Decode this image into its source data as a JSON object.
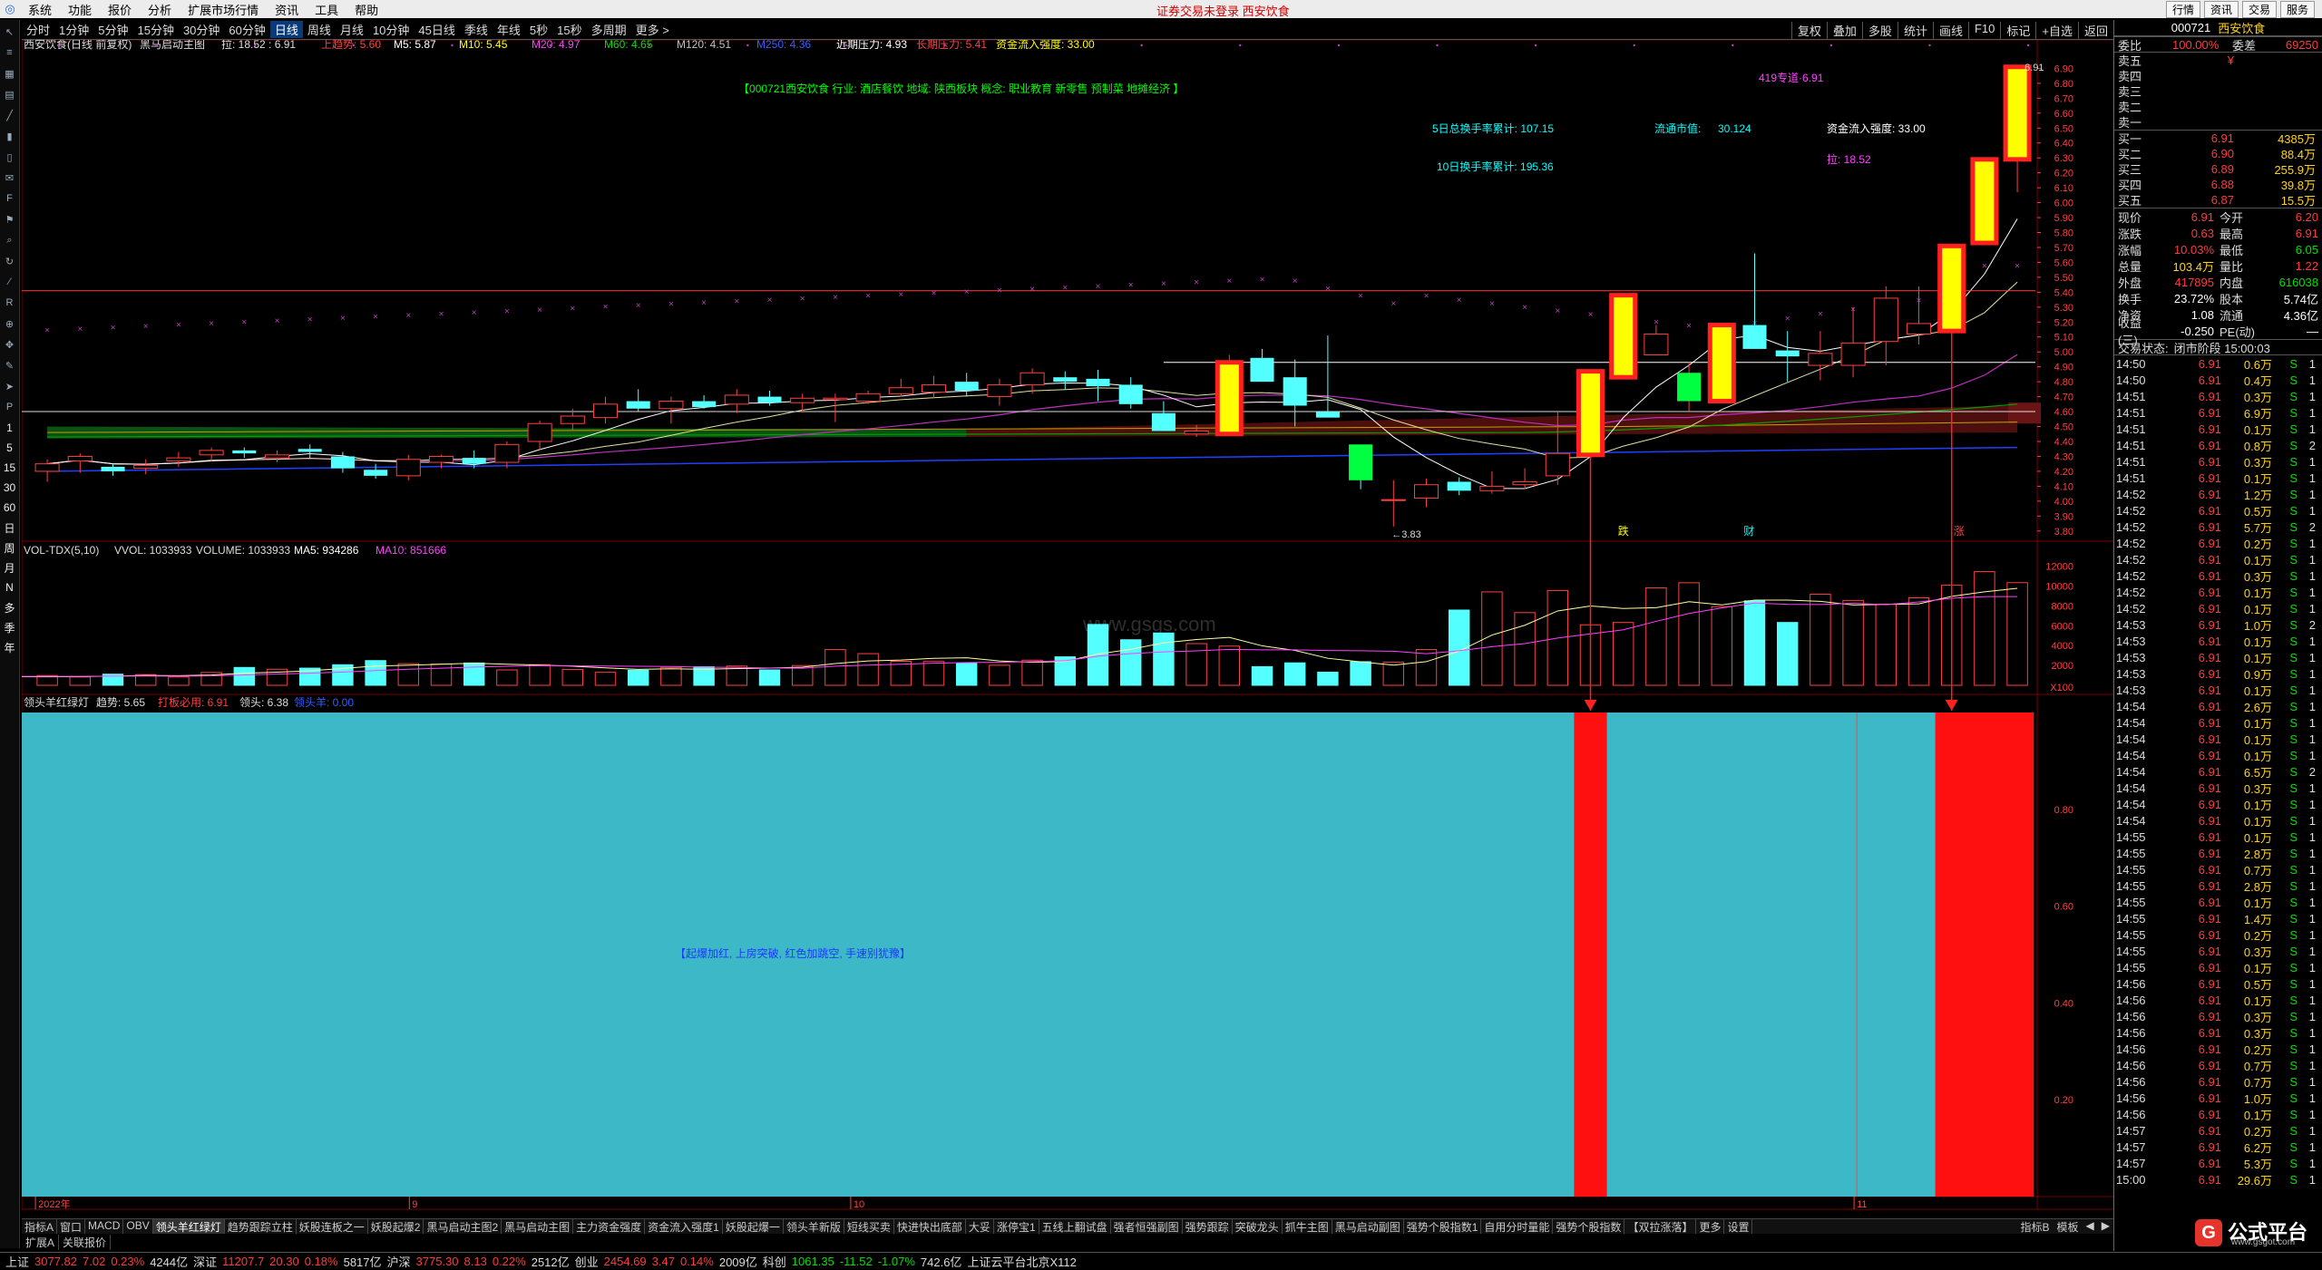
{
  "menubar": {
    "items": [
      "系统",
      "功能",
      "报价",
      "分析",
      "扩展市场行情",
      "资讯",
      "工具",
      "帮助"
    ],
    "center_text": "证券交易未登录  西安饮食",
    "right_buttons": [
      "行情",
      "资讯",
      "交易",
      "服务"
    ]
  },
  "periodbar": {
    "items": [
      "分时",
      "1分钟",
      "5分钟",
      "15分钟",
      "30分钟",
      "60分钟",
      "日线",
      "周线",
      "月线",
      "10分钟",
      "45日线",
      "季线",
      "年线",
      "5秒",
      "15秒",
      "多周期",
      "更多 >"
    ],
    "active": "日线",
    "right_items": [
      "复权",
      "叠加",
      "多股",
      "统计",
      "画线",
      "F10",
      "标记",
      "+自选",
      "返回"
    ]
  },
  "lefttools": {
    "icons": [
      "cursor-icon",
      "list-icon",
      "grid-icon",
      "table-icon",
      "chart-icon",
      "candle-icon",
      "bars-icon",
      "news-icon",
      "f10-icon",
      "flag-icon",
      "search-icon",
      "refresh-icon",
      "line-icon",
      "rsi-icon",
      "zoom-icon",
      "move-icon",
      "pen-icon",
      "pointer-icon",
      "ps-icon"
    ],
    "cycle_labels": [
      "1",
      "5",
      "15",
      "30",
      "60",
      "日",
      "周",
      "月",
      "N",
      "多",
      "季",
      "年"
    ]
  },
  "main_info": {
    "stock_label": "西安饮食(日线 前复权)",
    "indicator_name": "黑马启动主图",
    "values_text": "拉: 18.52 : 6.91",
    "ma_items": [
      {
        "text": "上趋势: 5.60",
        "color": "#ff4040"
      },
      {
        "text": "M5: 5.87",
        "color": "#ffffff"
      },
      {
        "text": "M10: 5.45",
        "color": "#ffff00"
      },
      {
        "text": "M20: 4.97",
        "color": "#ff40ff"
      },
      {
        "text": "M60: 4.65",
        "color": "#00e000"
      },
      {
        "text": "M120: 4.51",
        "color": "#c0c0c0"
      },
      {
        "text": "M250: 4.36",
        "color": "#3060ff"
      },
      {
        "text": "近期压力: 4.93",
        "color": "#ffffff"
      },
      {
        "text": "长期压力: 5.41",
        "color": "#ff4040"
      },
      {
        "text": "资金流入强度: 33.00",
        "color": "#ffff00"
      }
    ],
    "info_bar": "【000721西安饮食  行业: 酒店餐饮  地域: 陕西板块  概念: 职业教育 新零售 预制菜 地摊经济 】",
    "header_419": "419专道·6.91",
    "peak_label": "6.91",
    "low_label": "3.83",
    "stats": [
      {
        "label": "5日总换手率累计: 107.15"
      },
      {
        "label": "流通市值:",
        "value": "30.124"
      },
      {
        "label": "资金流入强度: 33.00"
      },
      {
        "label": "拉: 18.52"
      },
      {
        "label": "10日换手率累计: 195.36"
      }
    ],
    "watermark": "www.gsgs.com",
    "markers": [
      "跌",
      "财",
      "涨"
    ]
  },
  "volume_info": {
    "name": "VOL-TDX(5,10)",
    "vvol": "VVOL: 1033933",
    "volume": "VOLUME: 1033933",
    "ma5": "MA5: 934286",
    "ma10": "MA10: 851666",
    "unit": "X100"
  },
  "signal_info": {
    "name": "领头羊红绿灯",
    "trend": "趋势: 5.65",
    "stop": "打板必用: 6.91",
    "lead": "领头: 6.38",
    "lead_hard": "领头羊: 0.00",
    "center_text": "【起爆加红, 上房突破, 红色加跳空, 手速别犹豫】"
  },
  "xaxis": {
    "labels": [
      "2022年",
      "9",
      "10",
      "11"
    ]
  },
  "chart_data": [
    {
      "type": "candlestick",
      "title": "黑马启动主图",
      "y_ticks": [
        "6.90",
        "6.80",
        "6.70",
        "6.60",
        "6.50",
        "6.40",
        "6.30",
        "6.20",
        "6.10",
        "6.00",
        "5.90",
        "5.80",
        "5.70",
        "5.60",
        "5.50",
        "5.40",
        "5.30",
        "5.20",
        "5.10",
        "5.00",
        "4.90",
        "4.80",
        "4.70",
        "4.60",
        "4.50",
        "4.40",
        "4.30",
        "4.20",
        "4.10",
        "4.00",
        "3.90",
        "3.80"
      ],
      "ylim": [
        3.75,
        7.03
      ],
      "candles": [
        [
          4.2,
          4.28,
          4.13,
          4.25
        ],
        [
          4.27,
          4.32,
          4.19,
          4.3
        ],
        [
          4.23,
          4.25,
          4.17,
          4.2
        ],
        [
          4.22,
          4.28,
          4.18,
          4.24
        ],
        [
          4.27,
          4.33,
          4.23,
          4.29
        ],
        [
          4.31,
          4.36,
          4.27,
          4.34
        ],
        [
          4.34,
          4.36,
          4.29,
          4.32
        ],
        [
          4.29,
          4.34,
          4.26,
          4.31
        ],
        [
          4.35,
          4.38,
          4.29,
          4.33
        ],
        [
          4.3,
          4.33,
          4.19,
          4.22
        ],
        [
          4.21,
          4.25,
          4.15,
          4.17
        ],
        [
          4.17,
          4.31,
          4.14,
          4.28
        ],
        [
          4.26,
          4.31,
          4.22,
          4.3
        ],
        [
          4.29,
          4.34,
          4.22,
          4.25
        ],
        [
          4.26,
          4.4,
          4.22,
          4.38
        ],
        [
          4.4,
          4.54,
          4.34,
          4.52
        ],
        [
          4.52,
          4.62,
          4.47,
          4.57
        ],
        [
          4.56,
          4.7,
          4.52,
          4.65
        ],
        [
          4.67,
          4.75,
          4.6,
          4.62
        ],
        [
          4.62,
          4.7,
          4.52,
          4.67
        ],
        [
          4.67,
          4.71,
          4.62,
          4.63
        ],
        [
          4.65,
          4.75,
          4.59,
          4.71
        ],
        [
          4.7,
          4.74,
          4.64,
          4.66
        ],
        [
          4.66,
          4.72,
          4.6,
          4.69
        ],
        [
          4.68,
          4.72,
          4.53,
          4.69
        ],
        [
          4.67,
          4.74,
          4.65,
          4.72
        ],
        [
          4.72,
          4.82,
          4.7,
          4.76
        ],
        [
          4.73,
          4.84,
          4.69,
          4.78
        ],
        [
          4.8,
          4.86,
          4.7,
          4.74
        ],
        [
          4.7,
          4.82,
          4.64,
          4.78
        ],
        [
          4.78,
          4.89,
          4.72,
          4.86
        ],
        [
          4.83,
          4.87,
          4.75,
          4.8
        ],
        [
          4.82,
          4.88,
          4.67,
          4.77
        ],
        [
          4.78,
          4.83,
          4.62,
          4.65
        ],
        [
          4.59,
          4.67,
          4.47,
          4.47
        ],
        [
          4.45,
          4.51,
          4.43,
          4.47
        ],
        [
          4.45,
          4.98,
          4.44,
          4.93
        ],
        [
          4.96,
          5.02,
          4.82,
          4.8
        ],
        [
          4.83,
          4.95,
          4.5,
          4.64
        ],
        [
          4.6,
          5.11,
          4.56,
          4.56
        ],
        [
          4.38,
          4.36,
          4.08,
          4.14
        ],
        [
          4.01,
          4.14,
          3.83,
          4.01
        ],
        [
          4.02,
          4.15,
          3.96,
          4.11
        ],
        [
          4.13,
          4.16,
          4.04,
          4.07
        ],
        [
          4.07,
          4.2,
          4.05,
          4.1
        ],
        [
          4.11,
          4.22,
          4.08,
          4.13
        ],
        [
          4.17,
          4.6,
          4.11,
          4.32
        ],
        [
          4.31,
          4.87,
          4.31,
          4.87
        ],
        [
          4.83,
          5.38,
          4.83,
          5.38
        ],
        [
          4.98,
          5.18,
          4.98,
          5.12
        ],
        [
          4.67,
          4.93,
          4.6,
          4.86
        ],
        [
          4.67,
          5.18,
          4.67,
          5.18
        ],
        [
          5.18,
          5.66,
          5.02,
          5.02
        ],
        [
          5.01,
          5.14,
          4.8,
          4.97
        ],
        [
          4.91,
          5.14,
          4.81,
          4.99
        ],
        [
          4.91,
          5.3,
          4.83,
          5.06
        ],
        [
          5.07,
          5.44,
          4.91,
          5.36
        ],
        [
          5.12,
          5.44,
          5.05,
          5.19
        ],
        [
          5.14,
          5.71,
          5.14,
          5.71
        ],
        [
          5.73,
          6.29,
          5.73,
          6.29
        ],
        [
          6.29,
          6.91,
          6.07,
          6.91
        ]
      ],
      "ma_last": {
        "M5": 5.87,
        "M10": 5.45,
        "M20": 4.97,
        "M60": 4.65,
        "M120": 4.51,
        "M250": 4.36
      },
      "resistance_near": 4.93,
      "resistance_far": 5.41,
      "support_line": 4.6
    },
    {
      "type": "bar",
      "title": "VOL-TDX(5,10)",
      "y_ticks": [
        "12000",
        "10000",
        "8000",
        "6000",
        "4000",
        "2000"
      ],
      "ylim": [
        0,
        12600
      ],
      "values": [
        1035,
        1035,
        720,
        870,
        780,
        930,
        980,
        840,
        1120,
        1080,
        840,
        1290,
        1800,
        1620,
        1730,
        2070,
        2490,
        2180,
        2140,
        2250,
        1550,
        2080,
        1600,
        1310,
        1520,
        1800,
        1870,
        1940,
        1550,
        1990,
        3600,
        3190,
        2420,
        2400,
        2230,
        2020,
        2530,
        2870,
        6130,
        4590,
        5270,
        4200,
        3950,
        1880,
        2260,
        1320,
        2380,
        2340,
        3600,
        7580,
        9410,
        7320,
        9550,
        6090,
        6330,
        9820,
        10330,
        7920,
        8510,
        6330,
        9170,
        8550,
        8180,
        8810,
        10080,
        11450,
        10340
      ]
    },
    {
      "type": "bar",
      "title": "领头羊红绿灯",
      "y_ticks": [
        "0.80",
        "0.60",
        "0.40",
        "0.20"
      ],
      "ylim": [
        0,
        1.0
      ],
      "values_red_indices": [
        47,
        58,
        59,
        60
      ]
    }
  ],
  "bottomtabs": [
    "指标A",
    "窗口",
    "MACD",
    "OBV",
    "领头羊红绿灯",
    "趋势跟踪立柱",
    "妖股连板之一",
    "妖股起爆2",
    "黑马启动主图2",
    "黑马启动主图",
    "主力资金强度",
    "资金流入强度1",
    "妖股起爆一",
    "领头羊新版",
    "短线买卖",
    "快进快出底部",
    "大妥",
    "涨停宝1",
    "五线上翻试盘",
    "强者恒强副图",
    "强势跟踪",
    "突破龙头",
    "抓牛主图",
    "黑马启动副图",
    "强势个股指数1",
    "自用分时量能",
    "强势个股指数",
    "【双拉涨落】",
    "更多",
    "设置"
  ],
  "bottomtabs_active": "领头羊红绿灯",
  "bottomtabs_right": [
    "指标B",
    "模板",
    "◀",
    "▶"
  ],
  "bottomtabs2": [
    "扩展A",
    "关联报价"
  ],
  "statusbar": {
    "items": [
      {
        "text": "上证",
        "color": "wht"
      },
      {
        "text": "3077.82",
        "color": "red"
      },
      {
        "text": "7.02",
        "color": "red"
      },
      {
        "text": "0.23%",
        "color": "red"
      },
      {
        "text": "4244亿",
        "color": "wht"
      },
      {
        "text": "深证",
        "color": "wht"
      },
      {
        "text": "11207.7",
        "color": "red"
      },
      {
        "text": "20.30",
        "color": "red"
      },
      {
        "text": "0.18%",
        "color": "red"
      },
      {
        "text": "5817亿",
        "color": "wht"
      },
      {
        "text": "沪深",
        "color": "wht"
      },
      {
        "text": "3775.30",
        "color": "red"
      },
      {
        "text": "8.13",
        "color": "red"
      },
      {
        "text": "0.22%",
        "color": "red"
      },
      {
        "text": "2512亿",
        "color": "wht"
      },
      {
        "text": "创业",
        "color": "wht"
      },
      {
        "text": "2454.69",
        "color": "red"
      },
      {
        "text": "3.47",
        "color": "red"
      },
      {
        "text": "0.14%",
        "color": "red"
      },
      {
        "text": "2009亿",
        "color": "wht"
      },
      {
        "text": "科创",
        "color": "wht"
      },
      {
        "text": "1061.35",
        "color": "grn"
      },
      {
        "text": "-11.52",
        "color": "grn"
      },
      {
        "text": "-1.07%",
        "color": "grn"
      },
      {
        "text": "742.6亿",
        "color": "wht"
      },
      {
        "text": "上证云平台北京X112",
        "color": "wht"
      }
    ]
  },
  "rightpanel": {
    "code": "000721",
    "name": "西安饮食",
    "weibi_label": "委比",
    "weibi": "100.00%",
    "weicha_label": "委差",
    "weicha": "69250",
    "sells": [
      {
        "label": "卖五",
        "price": "¥",
        "vol": ""
      },
      {
        "label": "卖四",
        "price": "",
        "vol": ""
      },
      {
        "label": "卖三",
        "price": "",
        "vol": ""
      },
      {
        "label": "卖二",
        "price": "",
        "vol": ""
      },
      {
        "label": "卖一",
        "price": "",
        "vol": ""
      }
    ],
    "buys": [
      {
        "label": "买一",
        "price": "6.91",
        "vol": "4385万"
      },
      {
        "label": "买二",
        "price": "6.90",
        "vol": "88.4万"
      },
      {
        "label": "买三",
        "price": "6.89",
        "vol": "255.9万"
      },
      {
        "label": "买四",
        "price": "6.88",
        "vol": "39.8万"
      },
      {
        "label": "买五",
        "price": "6.87",
        "vol": "15.5万"
      }
    ],
    "quotes": [
      {
        "a": "现价",
        "b": "6.91",
        "bc": "red",
        "c": "今开",
        "d": "6.20",
        "dc": "red"
      },
      {
        "a": "涨跌",
        "b": "0.63",
        "bc": "red",
        "c": "最高",
        "d": "6.91",
        "dc": "red"
      },
      {
        "a": "涨幅",
        "b": "10.03%",
        "bc": "red",
        "c": "最低",
        "d": "6.05",
        "dc": "grn"
      },
      {
        "a": "总量",
        "b": "103.4万",
        "bc": "yel",
        "c": "量比",
        "d": "1.22",
        "dc": "red"
      },
      {
        "a": "外盘",
        "b": "417895",
        "bc": "red",
        "c": "内盘",
        "d": "616038",
        "dc": "grn"
      },
      {
        "a": "换手",
        "b": "23.72%",
        "bc": "wht",
        "c": "股本",
        "d": "5.74亿",
        "dc": "wht"
      },
      {
        "a": "净资",
        "b": "1.08",
        "bc": "wht",
        "c": "流通",
        "d": "4.36亿",
        "dc": "wht"
      },
      {
        "a": "收益(三)",
        "b": "-0.250",
        "bc": "wht",
        "c": "PE(动)",
        "d": "—",
        "dc": "wht"
      }
    ],
    "state_label": "交易状态:",
    "state": "闭市阶段 15:00:03",
    "ticks": [
      [
        "14:50",
        "6.91",
        "0.6万",
        "S",
        "1"
      ],
      [
        "14:50",
        "6.91",
        "0.4万",
        "S",
        "1"
      ],
      [
        "14:51",
        "6.91",
        "0.3万",
        "S",
        "1"
      ],
      [
        "14:51",
        "6.91",
        "6.9万",
        "S",
        "1"
      ],
      [
        "14:51",
        "6.91",
        "0.1万",
        "S",
        "1"
      ],
      [
        "14:51",
        "6.91",
        "0.8万",
        "S",
        "2"
      ],
      [
        "14:51",
        "6.91",
        "0.3万",
        "S",
        "1"
      ],
      [
        "14:51",
        "6.91",
        "0.1万",
        "S",
        "1"
      ],
      [
        "14:52",
        "6.91",
        "1.2万",
        "S",
        "1"
      ],
      [
        "14:52",
        "6.91",
        "0.5万",
        "S",
        "1"
      ],
      [
        "14:52",
        "6.91",
        "5.7万",
        "S",
        "2"
      ],
      [
        "14:52",
        "6.91",
        "0.2万",
        "S",
        "1"
      ],
      [
        "14:52",
        "6.91",
        "0.1万",
        "S",
        "1"
      ],
      [
        "14:52",
        "6.91",
        "0.3万",
        "S",
        "1"
      ],
      [
        "14:52",
        "6.91",
        "0.1万",
        "S",
        "1"
      ],
      [
        "14:52",
        "6.91",
        "0.1万",
        "S",
        "1"
      ],
      [
        "14:53",
        "6.91",
        "1.0万",
        "S",
        "2"
      ],
      [
        "14:53",
        "6.91",
        "0.1万",
        "S",
        "1"
      ],
      [
        "14:53",
        "6.91",
        "0.1万",
        "S",
        "1"
      ],
      [
        "14:53",
        "6.91",
        "0.9万",
        "S",
        "1"
      ],
      [
        "14:53",
        "6.91",
        "0.1万",
        "S",
        "1"
      ],
      [
        "14:54",
        "6.91",
        "2.6万",
        "S",
        "1"
      ],
      [
        "14:54",
        "6.91",
        "0.1万",
        "S",
        "1"
      ],
      [
        "14:54",
        "6.91",
        "0.1万",
        "S",
        "1"
      ],
      [
        "14:54",
        "6.91",
        "0.1万",
        "S",
        "1"
      ],
      [
        "14:54",
        "6.91",
        "6.5万",
        "S",
        "2"
      ],
      [
        "14:54",
        "6.91",
        "0.3万",
        "S",
        "1"
      ],
      [
        "14:54",
        "6.91",
        "0.1万",
        "S",
        "1"
      ],
      [
        "14:54",
        "6.91",
        "0.1万",
        "S",
        "1"
      ],
      [
        "14:55",
        "6.91",
        "0.1万",
        "S",
        "1"
      ],
      [
        "14:55",
        "6.91",
        "2.8万",
        "S",
        "1"
      ],
      [
        "14:55",
        "6.91",
        "0.7万",
        "S",
        "1"
      ],
      [
        "14:55",
        "6.91",
        "2.8万",
        "S",
        "1"
      ],
      [
        "14:55",
        "6.91",
        "0.1万",
        "S",
        "1"
      ],
      [
        "14:55",
        "6.91",
        "1.4万",
        "S",
        "1"
      ],
      [
        "14:55",
        "6.91",
        "0.2万",
        "S",
        "1"
      ],
      [
        "14:55",
        "6.91",
        "0.3万",
        "S",
        "1"
      ],
      [
        "14:55",
        "6.91",
        "0.1万",
        "S",
        "1"
      ],
      [
        "14:56",
        "6.91",
        "0.5万",
        "S",
        "1"
      ],
      [
        "14:56",
        "6.91",
        "0.1万",
        "S",
        "1"
      ],
      [
        "14:56",
        "6.91",
        "0.3万",
        "S",
        "1"
      ],
      [
        "14:56",
        "6.91",
        "0.3万",
        "S",
        "1"
      ],
      [
        "14:56",
        "6.91",
        "0.2万",
        "S",
        "1"
      ],
      [
        "14:56",
        "6.91",
        "0.7万",
        "S",
        "1"
      ],
      [
        "14:56",
        "6.91",
        "0.7万",
        "S",
        "1"
      ],
      [
        "14:56",
        "6.91",
        "1.0万",
        "S",
        "1"
      ],
      [
        "14:56",
        "6.91",
        "0.1万",
        "S",
        "1"
      ],
      [
        "14:57",
        "6.91",
        "0.2万",
        "S",
        "1"
      ],
      [
        "14:57",
        "6.91",
        "6.2万",
        "S",
        "1"
      ],
      [
        "14:57",
        "6.91",
        "5.3万",
        "S",
        "1"
      ],
      [
        "15:00",
        "6.91",
        "29.6万",
        "S",
        "1"
      ]
    ]
  },
  "brand": {
    "name": "公式平台",
    "url": "www.gsgot.com"
  }
}
